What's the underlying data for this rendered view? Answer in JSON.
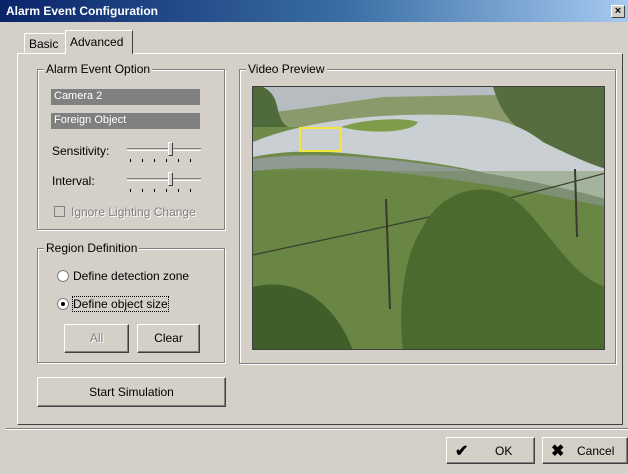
{
  "window": {
    "title": "Alarm Event Configuration",
    "close_glyph": "×"
  },
  "tabs": [
    {
      "label": "Basic",
      "active": false
    },
    {
      "label": "Advanced",
      "active": true
    }
  ],
  "alarm_event_option": {
    "title": "Alarm Event Option",
    "camera": "Camera 2",
    "event_type": "Foreign Object",
    "sensitivity_label": "Sensitivity:",
    "sensitivity_level": 0.6,
    "interval_label": "Interval:",
    "interval_level": 0.6,
    "ignore_lighting_label": "Ignore Lighting Change",
    "ignore_lighting_checked": false
  },
  "region_definition": {
    "title": "Region Definition",
    "option_zone": "Define detection zone",
    "option_size": "Define object size",
    "selected": "size",
    "all_button": "All",
    "clear_button": "Clear"
  },
  "simulation_button": "Start Simulation",
  "video_preview": {
    "title": "Video Preview",
    "highlight_color": "#f4e63a"
  },
  "footer": {
    "ok_label": "OK",
    "cancel_label": "Cancel"
  }
}
